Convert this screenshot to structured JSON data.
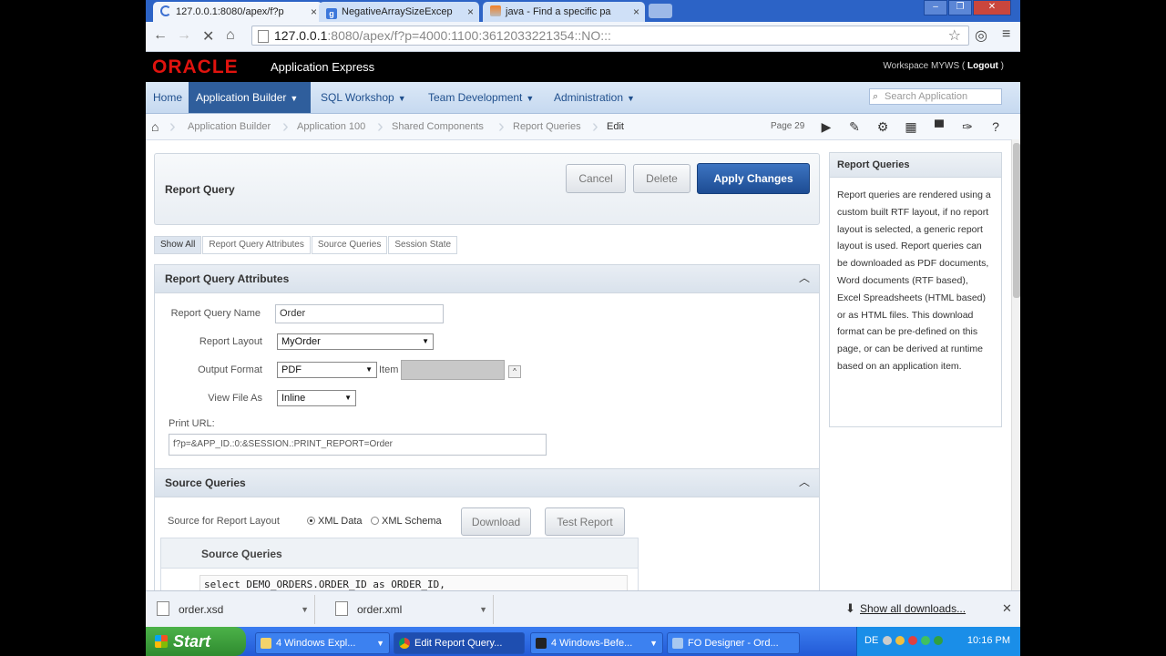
{
  "browser": {
    "tabs": [
      {
        "title": "127.0.0.1:8080/apex/f?p",
        "icon": "loading-icon"
      },
      {
        "title": "NegativeArraySizeExcep",
        "icon": "google-icon"
      },
      {
        "title": "java - Find a specific pa",
        "icon": "stackoverflow-icon"
      }
    ],
    "url_host": "127.0.0.1",
    "url_rest": ":8080/apex/f?p=4000:1100:3612033221354::NO:::"
  },
  "header": {
    "logo": "ORACLE",
    "product": "Application Express",
    "workspace_label": "Workspace MYWS",
    "logout_label": "Logout"
  },
  "nav": {
    "items": [
      {
        "label": "Home"
      },
      {
        "label": "Application Builder"
      },
      {
        "label": "SQL Workshop"
      },
      {
        "label": "Team Development"
      },
      {
        "label": "Administration"
      }
    ],
    "search_placeholder": "Search Application"
  },
  "breadcrumb": {
    "items": [
      "Application Builder",
      "Application 100",
      "Shared Components",
      "Report Queries",
      "Edit"
    ],
    "page_label": "Page 29"
  },
  "report_query": {
    "title": "Report Query",
    "cancel_label": "Cancel",
    "delete_label": "Delete",
    "apply_label": "Apply Changes"
  },
  "filters": [
    "Show All",
    "Report Query Attributes",
    "Source Queries",
    "Session State"
  ],
  "attributes": {
    "title": "Report Query Attributes",
    "name_label": "Report Query Name",
    "name_value": "Order",
    "layout_label": "Report Layout",
    "layout_value": "MyOrder",
    "format_label": "Output Format",
    "format_value": "PDF",
    "item_label": "Item",
    "view_label": "View File As",
    "view_value": "Inline",
    "print_url_label": "Print URL:",
    "print_url_value": "f?p=&APP_ID.:0:&SESSION.:PRINT_REPORT=Order"
  },
  "source": {
    "title": "Source Queries",
    "layout_source_label": "Source for Report Layout",
    "radio_xml_data": "XML Data",
    "radio_xml_schema": "XML Schema",
    "download_label": "Download",
    "test_report_label": "Test Report",
    "table_header": "Source Queries",
    "sql_line": "select DEMO_ORDERS.ORDER_ID as ORDER_ID,"
  },
  "help": {
    "title": "Report Queries",
    "text": "Report queries are rendered using a custom built RTF layout, if no report layout is selected, a generic report layout is used. Report queries can be downloaded as PDF documents, Word documents (RTF based), Excel Spreadsheets (HTML based) or as HTML files. This download format can be pre-defined on this page, or can be derived at runtime based on an application item."
  },
  "downloads": {
    "items": [
      "order.xsd",
      "order.xml"
    ],
    "show_all_label": "Show all downloads..."
  },
  "taskbar": {
    "start_label": "Start",
    "tasks": [
      {
        "label": "4 Windows Expl..."
      },
      {
        "label": "Edit Report Query..."
      },
      {
        "label": "4 Windows-Befe..."
      },
      {
        "label": "FO Designer - Ord..."
      }
    ],
    "lang": "DE",
    "time": "10:16 PM"
  }
}
